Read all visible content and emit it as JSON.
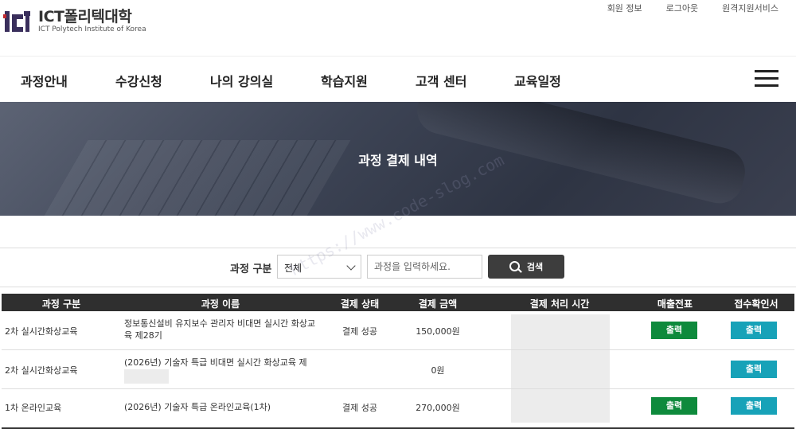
{
  "logo": {
    "title": "ICT폴리텍대학",
    "subtitle": "ICT Polytech Institute of Korea"
  },
  "util_links": [
    "회원 정보",
    "로그아웃",
    "원격지원서비스"
  ],
  "nav": [
    "과정안내",
    "수강신청",
    "나의 강의실",
    "학습지원",
    "고객 센터",
    "교육일정"
  ],
  "banner": {
    "title": "과정 결제 내역"
  },
  "search": {
    "label": "과정 구분",
    "select_value": "전체",
    "placeholder": "과정을 입력하세요.",
    "button": "검색"
  },
  "table": {
    "headers": [
      "과정 구분",
      "과정 이름",
      "결제 상태",
      "결제 금액",
      "결제 처리 시간",
      "매출전표",
      "접수확인서"
    ],
    "rows": [
      {
        "category": "2차 실시간화상교육",
        "name": "정보통신설비 유지보수 관리자 비대면 실시간 화상교육 제28기",
        "status": "결제 성공",
        "amount": "150,000원",
        "sales_button": "출력",
        "receipt_button": "출력"
      },
      {
        "category": "2차 실시간화상교육",
        "name": "(2026년) 기술자 특급 비대면 실시간 화상교육 제",
        "status": "",
        "amount": "0원",
        "sales_button": "",
        "receipt_button": "출력"
      },
      {
        "category": "1차 온라인교육",
        "name": "(2026년) 기술자 특급 온라인교육(1차)",
        "status": "결제 성공",
        "amount": "270,000원",
        "sales_button": "출력",
        "receipt_button": "출력"
      }
    ]
  },
  "watermark": "https://www.code-slog.com",
  "colors": {
    "header_bg": "#2f2f2f",
    "green": "#0e8a3c",
    "teal": "#17a2b8",
    "search_btn": "#3d3d3d"
  }
}
